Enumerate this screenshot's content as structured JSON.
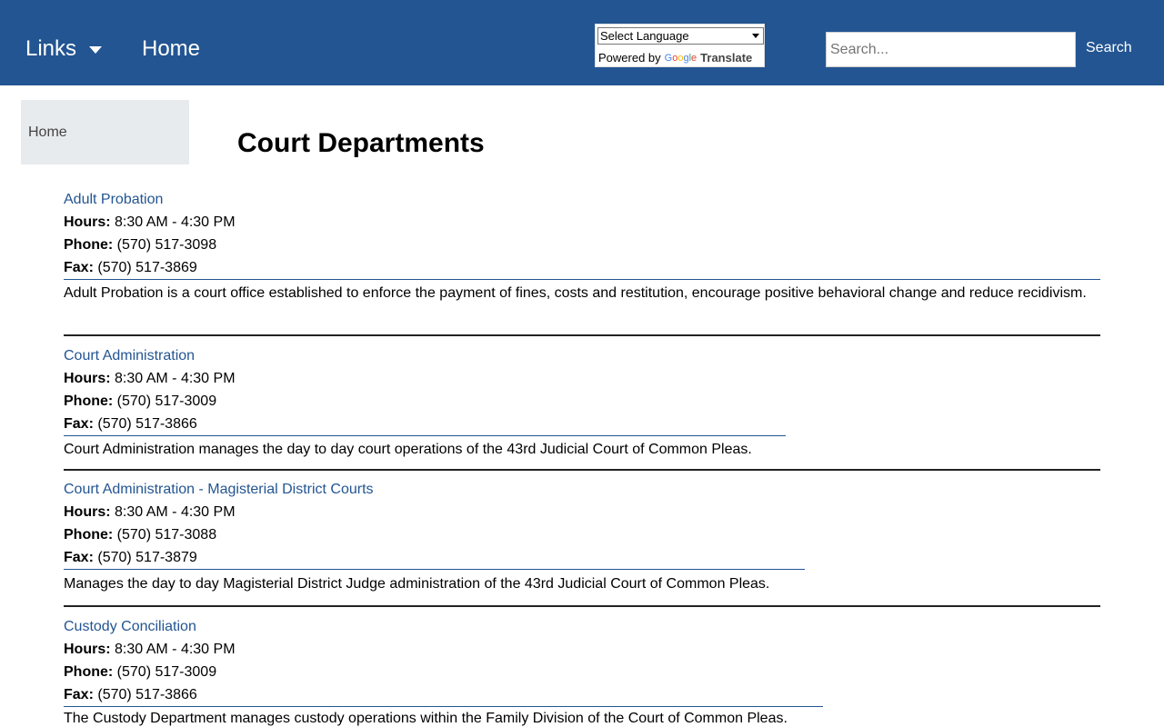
{
  "header": {
    "links_label": "Links",
    "home_label": "Home",
    "translate": {
      "select_label": "Select Language",
      "powered_by": "Powered by",
      "google": "Google",
      "translate_label": "Translate"
    },
    "search": {
      "placeholder": "Search...",
      "button_label": "Search"
    }
  },
  "breadcrumb": {
    "home": "Home"
  },
  "page": {
    "title": "Court Departments"
  },
  "labels": {
    "hours": "Hours:",
    "phone": "Phone:",
    "fax": "Fax:"
  },
  "departments": [
    {
      "name": "Adult Probation",
      "hours": "8:30 AM - 4:30 PM",
      "phone": "(570) 517-3098",
      "fax": "(570) 517-3869",
      "description": "Adult Probation is a court office established to enforce the payment of fines, costs and restitution, encourage positive behavioral change and reduce recidivism."
    },
    {
      "name": "Court Administration",
      "hours": "8:30 AM - 4:30 PM",
      "phone": "(570) 517-3009",
      "fax": "(570) 517-3866",
      "description": "Court Administration manages the day to day court operations of the 43rd Judicial Court of Common Pleas."
    },
    {
      "name": "Court Administration - Magisterial District Courts",
      "hours": "8:30 AM - 4:30 PM",
      "phone": "(570) 517-3088",
      "fax": "(570) 517-3879",
      "description": "Manages the day to day Magisterial District Judge administration of the 43rd Judicial Court of Common Pleas."
    },
    {
      "name": "Custody Conciliation",
      "hours": "8:30 AM - 4:30 PM",
      "phone": "(570) 517-3009",
      "fax": "(570) 517-3866",
      "description": "The Custody Department manages custody operations within the Family Division of the Court of Common Pleas."
    }
  ],
  "colors": {
    "header_bg": "#235592",
    "link": "#235592",
    "breadcrumb_bg": "#e8ebee"
  }
}
